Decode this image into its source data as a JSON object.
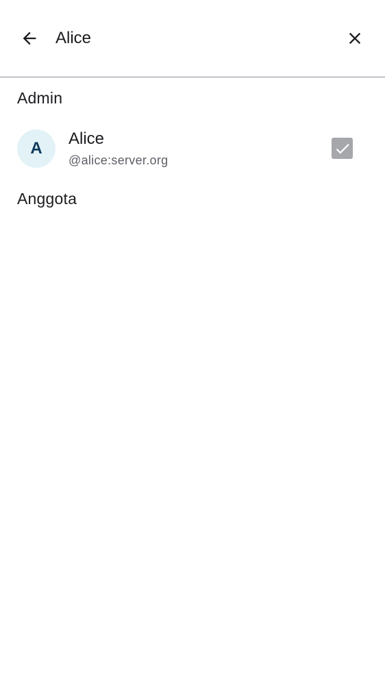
{
  "search": {
    "value": "Alice",
    "back_icon": "arrow-back-icon",
    "clear_icon": "close-icon"
  },
  "sections": {
    "admin_label": "Admin",
    "members_label": "Anggota"
  },
  "admins": [
    {
      "avatar_letter": "A",
      "display_name": "Alice",
      "user_id": "@alice:server.org",
      "selected": true,
      "enabled": false
    }
  ],
  "colors": {
    "avatar_background": "#e2f2f7",
    "avatar_text": "#0e3a5e",
    "checkbox_disabled": "#a6a7ab",
    "divider": "#8a8a95"
  }
}
